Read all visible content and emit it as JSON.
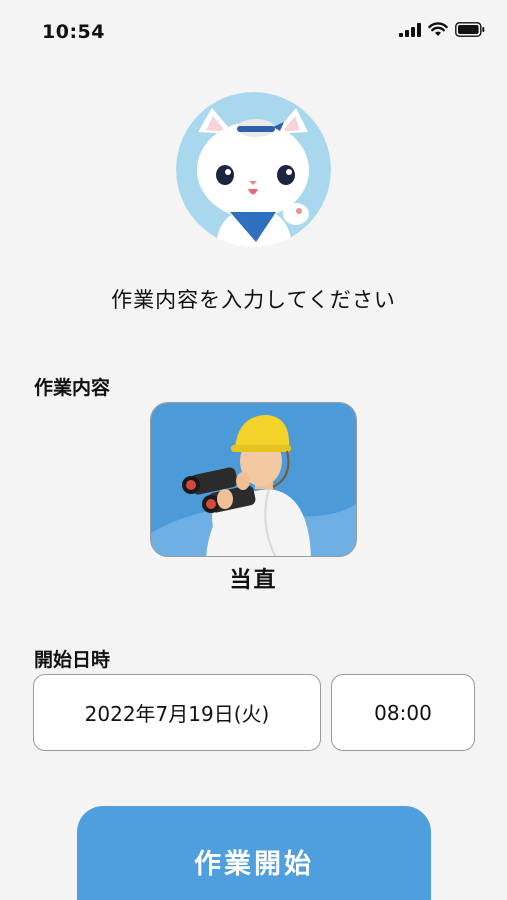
{
  "status_bar": {
    "time": "10:54",
    "icons": [
      "signal-icon",
      "wifi-icon",
      "battery-icon"
    ]
  },
  "avatar": {
    "icon": "cat-mascot-icon"
  },
  "prompt": "作業内容を入力してください",
  "work": {
    "section_label": "作業内容",
    "selected_name": "当直",
    "image_icon": "worker-binoculars-icon"
  },
  "start_datetime": {
    "section_label": "開始日時",
    "date": "2022年7月19日(火)",
    "time": "08:00"
  },
  "start_button_label": "作業開始",
  "colors": {
    "background": "#f4f4f4",
    "accent": "#4f9fdf",
    "card_blue": "#4c9ad8"
  }
}
